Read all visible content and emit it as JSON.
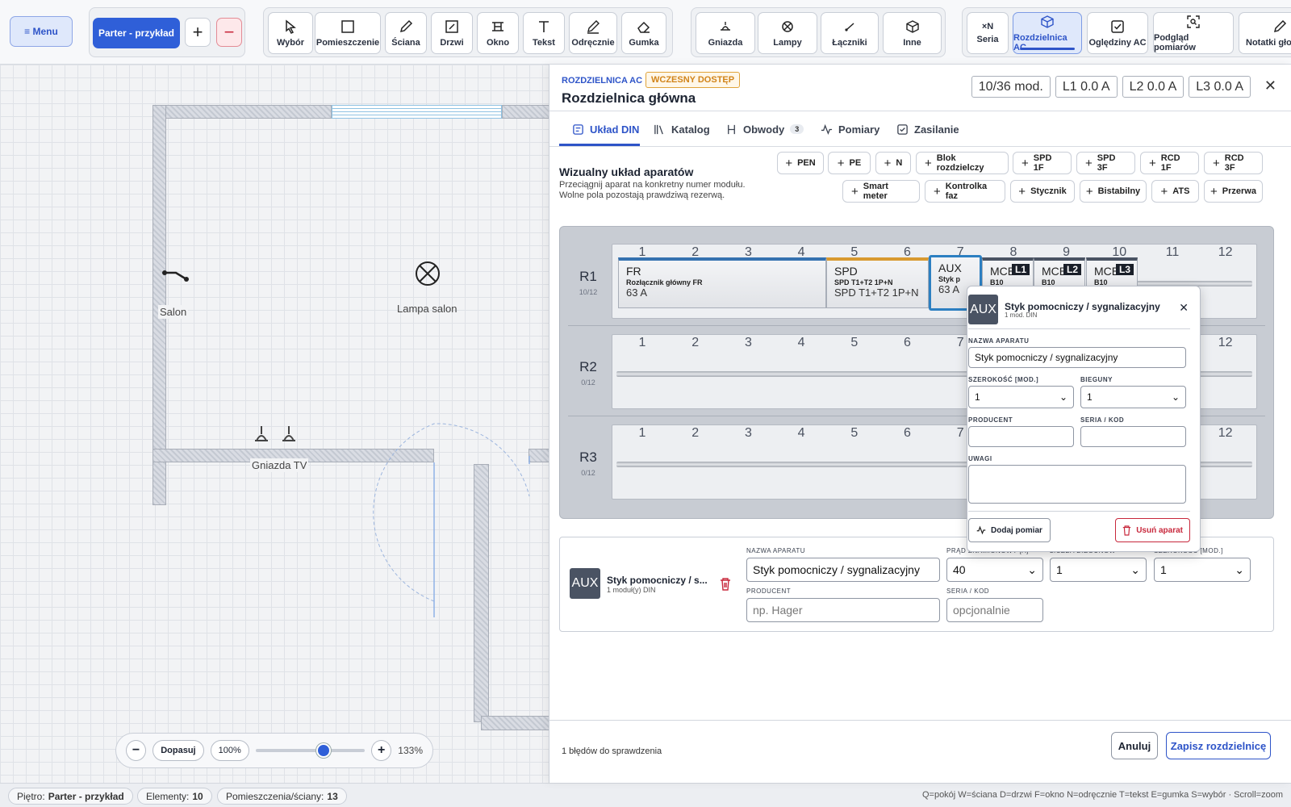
{
  "toolbar": {
    "menu_label": "≡ Menu",
    "floor_label": "Parter - przykład",
    "add_floor": "+",
    "remove_floor": "−",
    "tools": [
      {
        "label": "Wybór",
        "icon": "cursor-icon"
      },
      {
        "label": "Pomieszczenie",
        "icon": "room-icon"
      },
      {
        "label": "Ściana",
        "icon": "pen-icon"
      },
      {
        "label": "Drzwi",
        "icon": "door-icon"
      },
      {
        "label": "Okno",
        "icon": "window-icon"
      },
      {
        "label": "Tekst",
        "icon": "text-icon"
      },
      {
        "label": "Odręcznie",
        "icon": "freehand-icon"
      },
      {
        "label": "Gumka",
        "icon": "eraser-icon"
      }
    ],
    "electric": [
      {
        "label": "Gniazda",
        "icon": "socket-icon"
      },
      {
        "label": "Lampy",
        "icon": "lamp-icon"
      },
      {
        "label": "Łączniki",
        "icon": "switch-icon"
      },
      {
        "label": "Inne",
        "icon": "box-icon"
      }
    ],
    "views": [
      {
        "label": "Seria",
        "top": "×N"
      },
      {
        "label": "Rozdzielnica AC",
        "icon": "switchboard-icon",
        "active": true
      },
      {
        "label": "Oględziny AC",
        "icon": "checkbox-icon"
      },
      {
        "label": "Podgląd pomiarów",
        "icon": "scan-icon"
      },
      {
        "label": "Notatki głos",
        "icon": "mic-icon"
      }
    ]
  },
  "canvas": {
    "labels": {
      "salon": "Salon",
      "lampa": "Lampa salon",
      "gniazda": "Gniazda TV"
    },
    "zoom": {
      "fit_label": "Dopasuj",
      "reset_label": "100%",
      "value_label": "133%",
      "minus": "−",
      "plus": "+",
      "level": 0.6
    }
  },
  "statusbar": {
    "floor_label": "Piętro:",
    "floor_value": "Parter - przykład",
    "elements_label": "Elementy:",
    "elements_value": "10",
    "rooms_label": "Pomieszczenia/ściany:",
    "rooms_value": "13",
    "shortcuts": "Q=pokój W=ściana D=drzwi F=okno N=odręcznie T=tekst E=gumka S=wybór · Scroll=zoom"
  },
  "panel": {
    "kicker": "ROZDZIELNICA AC",
    "badge": "WCZESNY DOSTĘP",
    "title": "Rozdzielnica główna",
    "stats": [
      "10/36 mod.",
      "L1 0.0 A",
      "L2 0.0 A",
      "L3 0.0 A"
    ],
    "close": "✕",
    "tabs": [
      {
        "label": "Układ DIN",
        "active": true
      },
      {
        "label": "Katalog"
      },
      {
        "label": "Obwody",
        "count": "3"
      },
      {
        "label": "Pomiary"
      },
      {
        "label": "Zasilanie"
      }
    ],
    "section_title": "Wizualny układ aparatów",
    "section_hint1": "Przeciągnij aparat na konkretny numer modułu.",
    "section_hint2": "Wolne pola pozostają prawdziwą rezerwą.",
    "add_buttons_row1": [
      "PEN",
      "PE",
      "N",
      "Blok rozdzielczy",
      "SPD 1F",
      "SPD 3F",
      "RCD 1F",
      "RCD 3F"
    ],
    "add_buttons_row2": [
      "Smart meter",
      "Kontrolka faz",
      "Stycznik",
      "Bistabilny",
      "ATS",
      "Przerwa"
    ],
    "module_numbers": [
      "1",
      "2",
      "3",
      "4",
      "5",
      "6",
      "7",
      "8",
      "9",
      "10",
      "11",
      "12"
    ],
    "rails": [
      {
        "name": "R1",
        "count": "10/12"
      },
      {
        "name": "R2",
        "count": "0/12"
      },
      {
        "name": "R3",
        "count": "0/12"
      }
    ],
    "devices": [
      {
        "code": "FR",
        "name": "Rozłącznik główny FR",
        "value": "63 A"
      },
      {
        "code": "SPD",
        "name": "SPD T1+T2 1P+N",
        "value": "SPD T1+T2 1P+N"
      },
      {
        "code": "AUX",
        "name": "Styk p",
        "value": "63 A"
      },
      {
        "code": "MCB",
        "phase": "L1",
        "name": "B10"
      },
      {
        "code": "MCB",
        "phase": "L2",
        "name": "B10"
      },
      {
        "code": "MCB",
        "phase": "L3",
        "name": "B10"
      }
    ],
    "popup": {
      "icon_label": "AUX",
      "title": "Styk pomocniczy / sygnalizacyjny",
      "subtitle": "1 mod. DIN",
      "name_label": "NAZWA APARATU",
      "name_value": "Styk pomocniczy / sygnalizacyjny",
      "width_label": "SZEROKOŚĆ [MOD.]",
      "width_value": "1",
      "poles_label": "BIEGUNY",
      "poles_value": "1",
      "producer_label": "PRODUCENT",
      "series_label": "SERIA / KOD",
      "notes_label": "UWAGI",
      "add_measure": "Dodaj pomiar",
      "remove": "Usuń aparat"
    },
    "detail": {
      "icon_label": "AUX",
      "title": "Styk pomocniczy / s...",
      "subtitle": "1 moduł(y) DIN",
      "name_label": "NAZWA APARATU",
      "name_value": "Styk pomocniczy / sygnalizacyjny",
      "current_label": "PRĄD ZNAMIONOWY [A]",
      "current_value": "40",
      "poles_label": "LICZBA BIEGUNÓW",
      "poles_value": "1",
      "width_label": "SZEROKOŚĆ [MOD.]",
      "width_value": "1",
      "producer_label": "PRODUCENT",
      "producer_placeholder": "np. Hager",
      "series_label": "SERIA / KOD",
      "series_placeholder": "opcjonalnie"
    },
    "footer": {
      "errors": "1 błędów do sprawdzenia",
      "cancel": "Anuluj",
      "save": "Zapisz rozdzielnicę"
    }
  }
}
